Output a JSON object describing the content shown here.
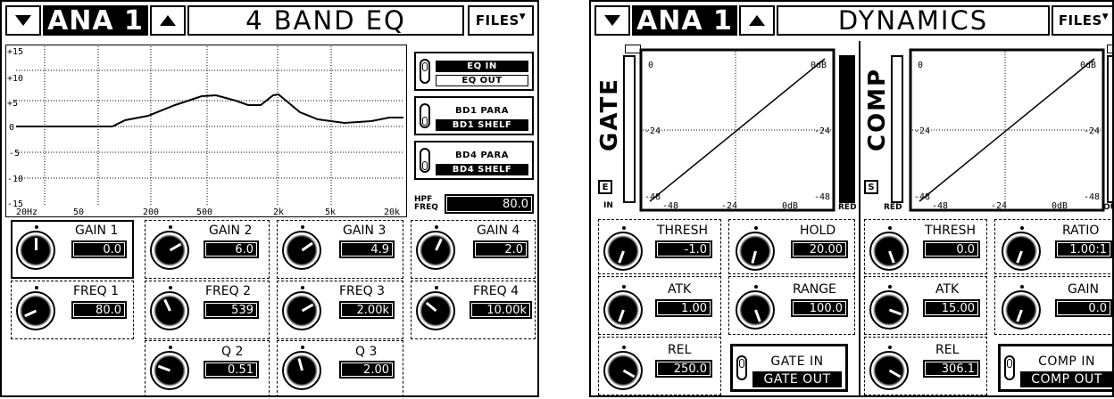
{
  "eq": {
    "channel": "ANA 1",
    "title": "4 BAND EQ",
    "files": "FILES",
    "graph": {
      "y_labels": [
        "+15",
        "+10",
        "+5",
        "0",
        "-5",
        "-10",
        "-15"
      ],
      "x_labels": [
        "20Hz",
        "50",
        "200",
        "500",
        "2k",
        "5k",
        "20k"
      ]
    },
    "switches": [
      {
        "on": "EQ IN",
        "off": "EQ OUT"
      },
      {
        "on": "BD1 PARA",
        "off": "BD1 SHELF"
      },
      {
        "on": "BD4 PARA",
        "off": "BD4 SHELF"
      }
    ],
    "hpf": {
      "label_1": "HPF",
      "label_2": "FREQ",
      "value": "80.0"
    },
    "params": {
      "gain1": {
        "label": "GAIN 1",
        "value": "0.0",
        "angle": 0
      },
      "gain2": {
        "label": "GAIN 2",
        "value": "6.0",
        "angle": 60
      },
      "gain3": {
        "label": "GAIN 3",
        "value": "4.9",
        "angle": 55
      },
      "gain4": {
        "label": "GAIN 4",
        "value": "2.0",
        "angle": 25
      },
      "freq1": {
        "label": "FREQ 1",
        "value": "80.0",
        "angle": -115
      },
      "freq2": {
        "label": "FREQ 2",
        "value": "539",
        "angle": -25
      },
      "freq3": {
        "label": "FREQ 3",
        "value": "2.00k",
        "angle": 60
      },
      "freq4": {
        "label": "FREQ 4",
        "value": "10.00k",
        "angle": -50
      },
      "q2": {
        "label": "Q 2",
        "value": "0.51",
        "angle": -70
      },
      "q3": {
        "label": "Q 3",
        "value": "2.00",
        "angle": -15
      }
    }
  },
  "dyn": {
    "channel": "ANA 1",
    "title": "DYNAMICS",
    "files": "FILES",
    "gate": {
      "label": "GATE",
      "e_label": "E",
      "in_label": "IN",
      "red_label": "RED",
      "axis": {
        "top": "0",
        "mid": "-24",
        "bot": "-48",
        "right_top": "0dB",
        "right_mid": "-24",
        "right_bot": "-48"
      },
      "x_axis": [
        "-48",
        "-24",
        "0dB"
      ]
    },
    "comp": {
      "label": "COMP",
      "s_label": "S",
      "red_label": "RED",
      "out_label": "OUT",
      "axis": {
        "top": "0",
        "mid": "-24",
        "bot": "-48",
        "right_top": "0dB",
        "right_mid": "-24",
        "right_bot": "-48"
      },
      "x_axis": [
        "-48",
        "-24",
        "0dB"
      ]
    },
    "params": {
      "gate_thresh": {
        "label": "THRESH",
        "value": "-1.0",
        "angle": -160
      },
      "gate_hold": {
        "label": "HOLD",
        "value": "20.00",
        "angle": -165
      },
      "gate_atk": {
        "label": "ATK",
        "value": "1.00",
        "angle": -160
      },
      "gate_range": {
        "label": "RANGE",
        "value": "100.0",
        "angle": 160
      },
      "gate_rel": {
        "label": "REL",
        "value": "250.0",
        "angle": 120
      },
      "comp_thresh": {
        "label": "THRESH",
        "value": "0.0",
        "angle": 160
      },
      "comp_ratio": {
        "label": "RATIO",
        "value": "1.00:1",
        "angle": -160
      },
      "comp_atk": {
        "label": "ATK",
        "value": "15.00",
        "angle": 110
      },
      "comp_gain": {
        "label": "GAIN",
        "value": "0.0",
        "angle": -160
      },
      "comp_rel": {
        "label": "REL",
        "value": "306.1",
        "angle": 120
      }
    },
    "gate_switch": {
      "on": "GATE IN",
      "off": "GATE OUT"
    },
    "comp_switch": {
      "on": "COMP IN",
      "off": "COMP OUT"
    }
  }
}
